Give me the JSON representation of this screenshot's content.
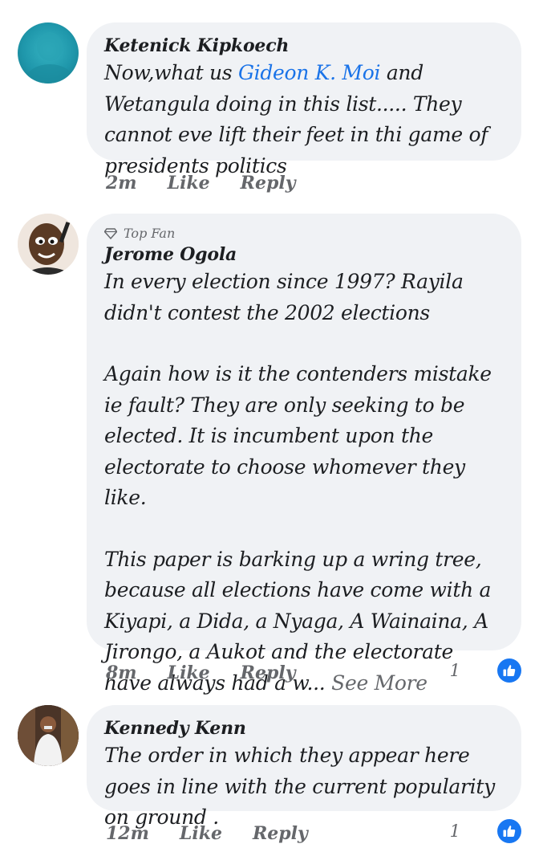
{
  "comments": [
    {
      "author": "Ketenick Kipkoech",
      "text_before": "Now,what us ",
      "mention": "Gideon K. Moi",
      "text_after": " and Wetangula doing in this list..... They cannot eve lift their feet in thi game of presidents politics",
      "time": "2m",
      "like": "Like",
      "reply": "Reply"
    },
    {
      "badge": "Top Fan",
      "author": "Jerome Ogola",
      "para1": "In every election since 1997? Rayila didn't contest the 2002 elections",
      "para2": "Again  how is it the contenders mistake ie fault? They are only seeking to be elected. It is incumbent upon the electorate to choose whomever they like.",
      "para3": "This paper is barking up a wring tree, because all elections have come with a Kiyapi, a Dida, a Nyaga, A Wainaina, A Jirongo, a Aukot and the electorate have always had a w...",
      "see_more": "See More",
      "time": "8m",
      "like": "Like",
      "reply": "Reply",
      "reaction_count": "1"
    },
    {
      "author": "Kennedy Kenn",
      "text": "The order in which they appear here goes in line with the current popularity on ground .",
      "time": "12m",
      "like": "Like",
      "reply": "Reply",
      "reaction_count": "1"
    }
  ]
}
